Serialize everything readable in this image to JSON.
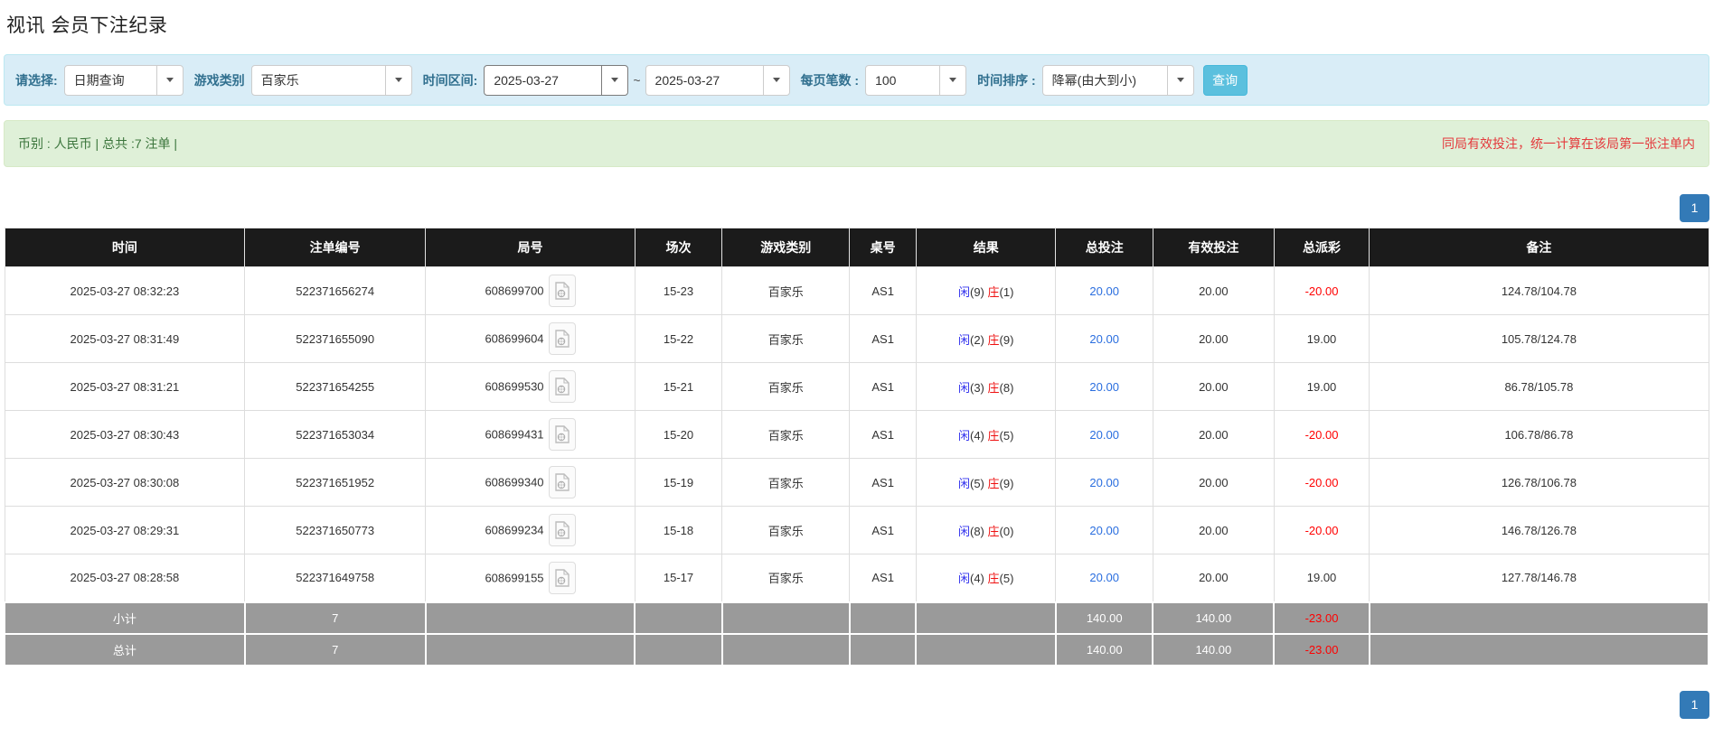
{
  "page_title": "视讯 会员下注纪录",
  "filter_bar": {
    "select_label": "请选择:",
    "select_value": "日期查询",
    "game_label": "游戏类别",
    "game_value": "百家乐",
    "range_label": "时间区间:",
    "date_from": "2025-03-27",
    "range_separator": "~",
    "date_to": "2025-03-27",
    "page_size_label": "每页笔数 :",
    "page_size_value": "100",
    "sort_label": "时间排序 :",
    "sort_value": "降幂(由大到小)",
    "query_button_label": "查询"
  },
  "notice_bar": {
    "left_text": "币别 : 人民币 | 总共 :7 注单 |",
    "right_text": "同局有效投注，统一计算在该局第一张注单内"
  },
  "pagination": {
    "current_page": "1"
  },
  "table": {
    "headers": [
      "时间",
      "注单编号",
      "局号",
      "场次",
      "游戏类别",
      "桌号",
      "结果",
      "总投注",
      "有效投注",
      "总派彩",
      "备注"
    ],
    "rows": [
      {
        "time": "2025-03-27 08:32:23",
        "bet_no": "522371656274",
        "round_no": "608699700",
        "session": "15-23",
        "game": "百家乐",
        "table_no": "AS1",
        "player": "闲",
        "player_score": "(9)",
        "banker": "庄",
        "banker_score": "(1)",
        "total_bet": "20.00",
        "valid_bet": "20.00",
        "payout": "-20.00",
        "remark": "124.78/104.78"
      },
      {
        "time": "2025-03-27 08:31:49",
        "bet_no": "522371655090",
        "round_no": "608699604",
        "session": "15-22",
        "game": "百家乐",
        "table_no": "AS1",
        "player": "闲",
        "player_score": "(2)",
        "banker": "庄",
        "banker_score": "(9)",
        "total_bet": "20.00",
        "valid_bet": "20.00",
        "payout": "19.00",
        "remark": "105.78/124.78"
      },
      {
        "time": "2025-03-27 08:31:21",
        "bet_no": "522371654255",
        "round_no": "608699530",
        "session": "15-21",
        "game": "百家乐",
        "table_no": "AS1",
        "player": "闲",
        "player_score": "(3)",
        "banker": "庄",
        "banker_score": "(8)",
        "total_bet": "20.00",
        "valid_bet": "20.00",
        "payout": "19.00",
        "remark": "86.78/105.78"
      },
      {
        "time": "2025-03-27 08:30:43",
        "bet_no": "522371653034",
        "round_no": "608699431",
        "session": "15-20",
        "game": "百家乐",
        "table_no": "AS1",
        "player": "闲",
        "player_score": "(4)",
        "banker": "庄",
        "banker_score": "(5)",
        "total_bet": "20.00",
        "valid_bet": "20.00",
        "payout": "-20.00",
        "remark": "106.78/86.78"
      },
      {
        "time": "2025-03-27 08:30:08",
        "bet_no": "522371651952",
        "round_no": "608699340",
        "session": "15-19",
        "game": "百家乐",
        "table_no": "AS1",
        "player": "闲",
        "player_score": "(5)",
        "banker": "庄",
        "banker_score": "(9)",
        "total_bet": "20.00",
        "valid_bet": "20.00",
        "payout": "-20.00",
        "remark": "126.78/106.78"
      },
      {
        "time": "2025-03-27 08:29:31",
        "bet_no": "522371650773",
        "round_no": "608699234",
        "session": "15-18",
        "game": "百家乐",
        "table_no": "AS1",
        "player": "闲",
        "player_score": "(8)",
        "banker": "庄",
        "banker_score": "(0)",
        "total_bet": "20.00",
        "valid_bet": "20.00",
        "payout": "-20.00",
        "remark": "146.78/126.78"
      },
      {
        "time": "2025-03-27 08:28:58",
        "bet_no": "522371649758",
        "round_no": "608699155",
        "session": "15-17",
        "game": "百家乐",
        "table_no": "AS1",
        "player": "闲",
        "player_score": "(4)",
        "banker": "庄",
        "banker_score": "(5)",
        "total_bet": "20.00",
        "valid_bet": "20.00",
        "payout": "19.00",
        "remark": "127.78/146.78"
      }
    ],
    "summary_rows": [
      {
        "label": "小计",
        "count": "7",
        "total_bet": "140.00",
        "valid_bet": "140.00",
        "payout": "-23.00",
        "remark": ""
      },
      {
        "label": "总计",
        "count": "7",
        "total_bet": "140.00",
        "valid_bet": "140.00",
        "payout": "-23.00",
        "remark": ""
      }
    ]
  },
  "icons": {
    "combo_caret": "caret-down",
    "round_video": "video-file"
  },
  "colors": {
    "filter_bg": "#d9edf7",
    "filter_border": "#bce8f1",
    "filter_label": "#31708f",
    "query_btn_bg": "#5bc0de",
    "notice_bg": "#dff0d8",
    "notice_text": "#3c763d",
    "notice_warn_text": "#e4393c",
    "table_header_bg": "#1b1b1b",
    "summary_row_bg": "#9a9a9a",
    "pager_bg": "#337ab7",
    "link_blue": "#2a6edf",
    "player_blue": "#3333ee",
    "banker_red": "#ee1111",
    "negative_red": "#ff0000"
  }
}
